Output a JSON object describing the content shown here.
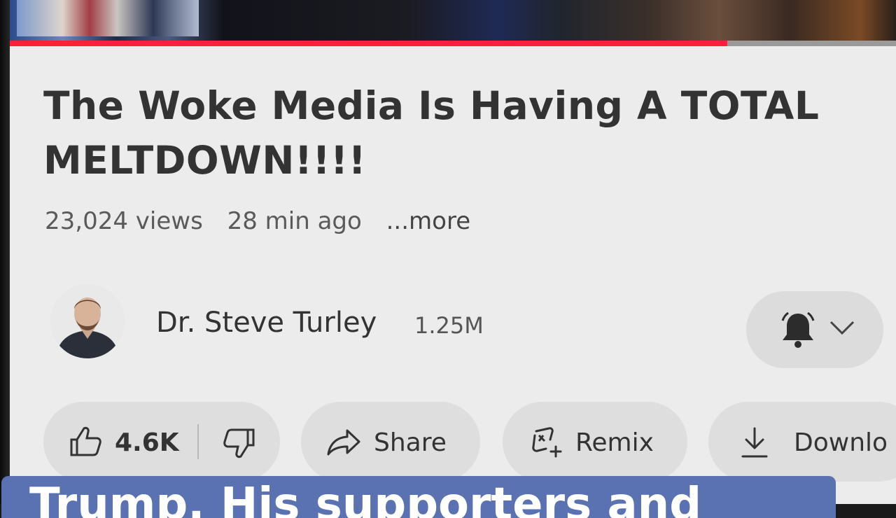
{
  "video": {
    "title": "The Woke Media Is Having A TOTAL MELTDOWN!!!!",
    "views": "23,024 views",
    "age": "28 min ago",
    "more_label": "...more",
    "progress_fraction": 0.81
  },
  "channel": {
    "name": "Dr. Steve Turley",
    "subscribers": "1.25M"
  },
  "actions": {
    "like_count": "4.6K",
    "share_label": "Share",
    "remix_label": "Remix",
    "download_label": "Downlo"
  },
  "caption": {
    "text": "Trump. His supporters and"
  },
  "colors": {
    "progress": "#ff1f3d",
    "caption_bg": "#5a72b2",
    "pill_bg": "#dedede"
  },
  "icons": [
    "thumbs-up-icon",
    "thumbs-down-icon",
    "share-arrow-icon",
    "remix-icon",
    "download-icon",
    "bell-icon",
    "chevron-down-icon"
  ]
}
